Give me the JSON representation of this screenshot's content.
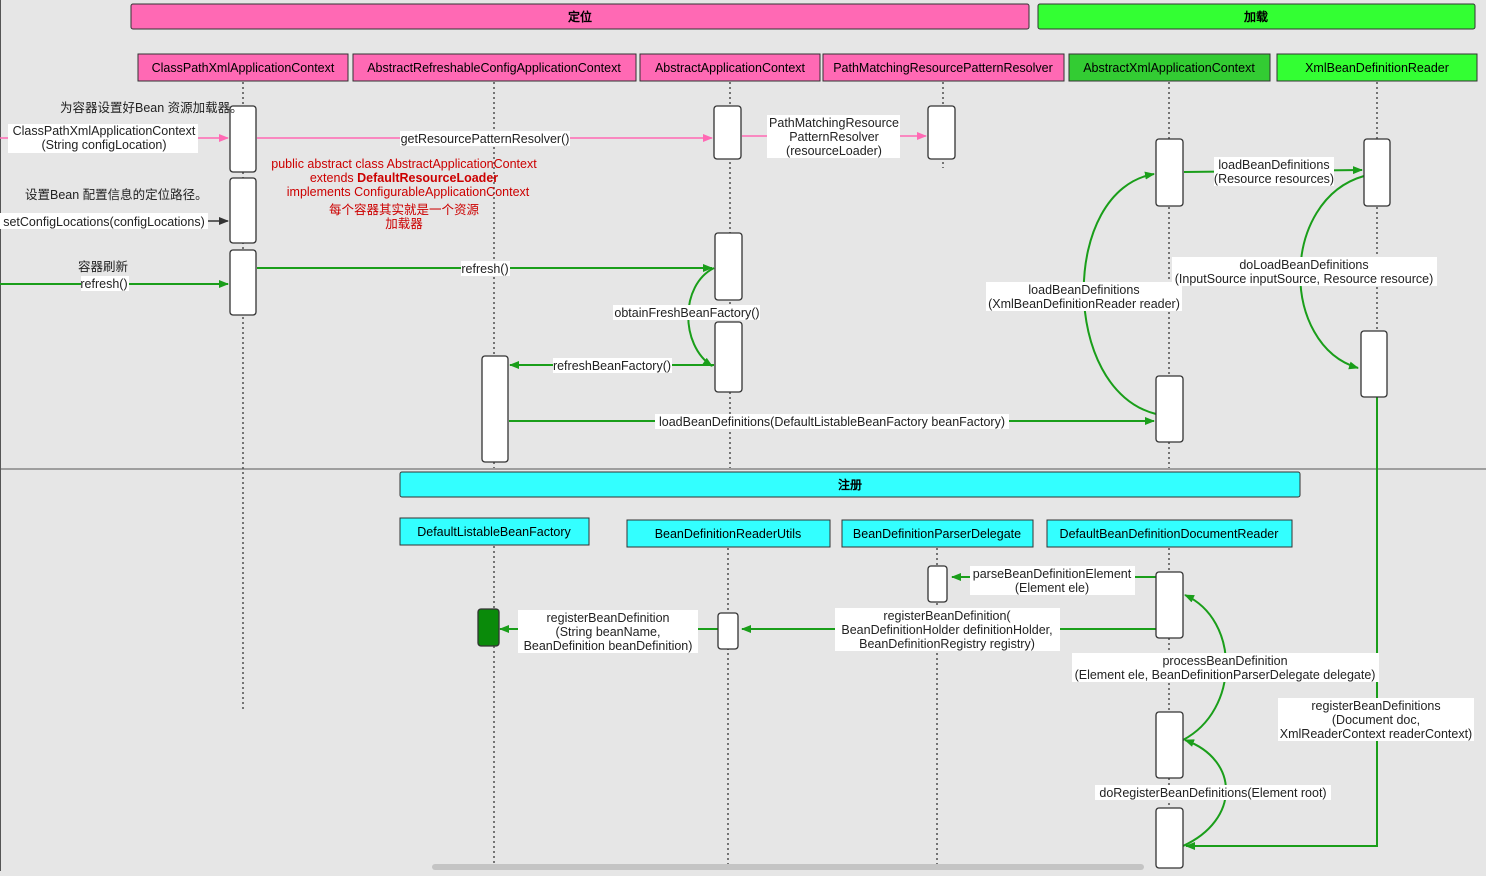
{
  "sections": {
    "locate": "定位",
    "load": "加载",
    "register": "注册"
  },
  "participants": [
    {
      "id": "cpx",
      "label": "ClassPathXmlApplicationContext",
      "group": "locate"
    },
    {
      "id": "arc",
      "label": "AbstractRefreshableConfigApplicationContext",
      "group": "locate"
    },
    {
      "id": "aac",
      "label": "AbstractApplicationContext",
      "group": "locate"
    },
    {
      "id": "pmr",
      "label": "PathMatchingResourcePatternResolver",
      "group": "locate"
    },
    {
      "id": "axa",
      "label": "AbstractXmlApplicationContext",
      "group": "load"
    },
    {
      "id": "xbr",
      "label": "XmlBeanDefinitionReader",
      "group": "load"
    },
    {
      "id": "dlbf",
      "label": "DefaultListableBeanFactory",
      "group": "register"
    },
    {
      "id": "bdru",
      "label": "BeanDefinitionReaderUtils",
      "group": "register"
    },
    {
      "id": "bdpd",
      "label": "BeanDefinitionParserDelegate",
      "group": "register"
    },
    {
      "id": "dbddr",
      "label": "DefaultBeanDefinitionDocumentReader",
      "group": "register"
    }
  ],
  "notes": {
    "resource_loader": "为容器设置好Bean 资源加载器。",
    "config_locations": "设置Bean 配置信息的定位路径。",
    "refresh_comment": "容器刷新",
    "aac_decl_1": "public abstract class AbstractApplicationContext",
    "aac_decl_2a": "extends ",
    "aac_decl_2b": "DefaultResourceLoader",
    "aac_decl_3": "implements ConfigurableApplicationContext",
    "aac_decl_4": "每个容器其实就是一个资源",
    "aac_decl_5": "加载器"
  },
  "messages": {
    "ctor_1": "ClassPathXmlApplicationContext",
    "ctor_2": "(String configLocation)",
    "get_resolver": "getResourcePatternResolver()",
    "pmr_new_1": "PathMatchingResource",
    "pmr_new_2": "PatternResolver",
    "pmr_new_3": "(resourceLoader)",
    "set_locations": "setConfigLocations(configLocations)",
    "refresh_call": "refresh()",
    "refresh": "refresh()",
    "obtain": "obtainFreshBeanFactory()",
    "refresh_bf": "refreshBeanFactory()",
    "load_bf": "loadBeanDefinitions(DefaultListableBeanFactory beanFactory)",
    "load_reader_1": "loadBeanDefinitions",
    "load_reader_2": "(XmlBeanDefinitionReader reader)",
    "load_res_1": "loadBeanDefinitions",
    "load_res_2": "(Resource resources)",
    "do_load_1": "doLoadBeanDefinitions",
    "do_load_2": "(InputSource inputSource, Resource resource)",
    "reg_defs_1": "registerBeanDefinitions",
    "reg_defs_2": "(Document doc,",
    "reg_defs_3": "XmlReaderContext readerContext)",
    "do_register": "doRegisterBeanDefinitions(Element root)",
    "process_1": "processBeanDefinition",
    "process_2": "(Element ele, BeanDefinitionParserDelegate delegate)",
    "parse_1": "parseBeanDefinitionElement",
    "parse_2": "(Element ele)",
    "reg_def_holder_1": "registerBeanDefinition(",
    "reg_def_holder_2": "BeanDefinitionHolder definitionHolder,",
    "reg_def_holder_3": "BeanDefinitionRegistry registry)",
    "reg_def_1": "registerBeanDefinition",
    "reg_def_2": "(String beanName,",
    "reg_def_3": "BeanDefinition beanDefinition)"
  },
  "colors": {
    "locate": "#ff69b4",
    "load": "#33ff33",
    "register": "#33ffff",
    "pink_arrow": "#ff69b4",
    "green_arrow": "#1a9e1a",
    "note_red": "#cc0000",
    "background": "#e6e6e6"
  }
}
